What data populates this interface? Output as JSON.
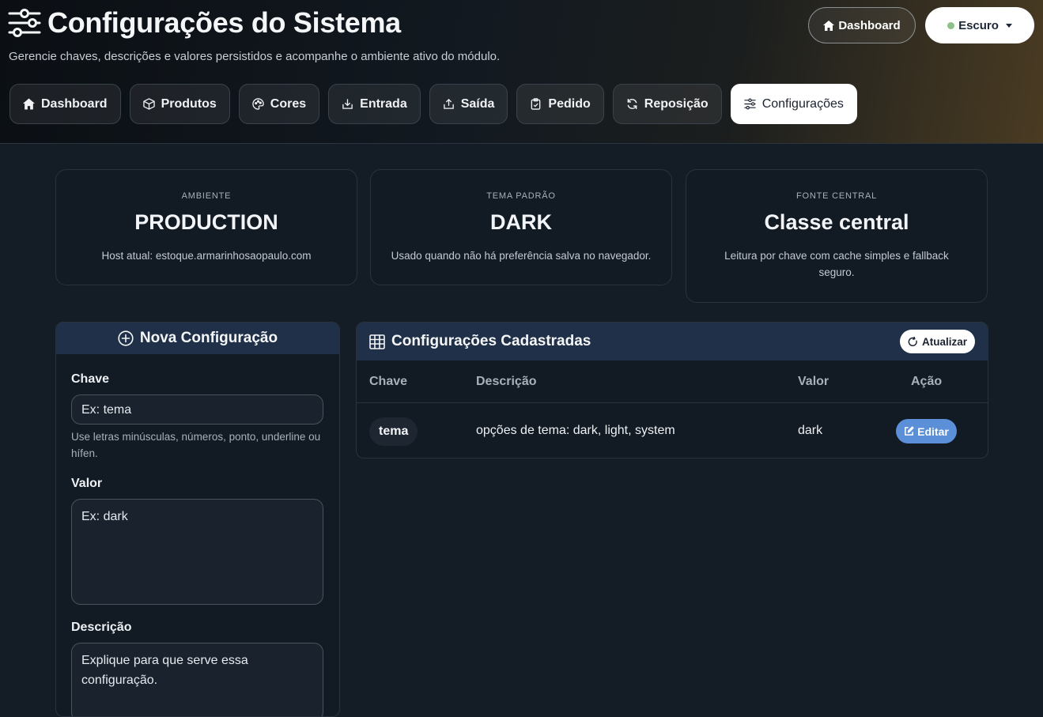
{
  "header": {
    "title": "Configurações do Sistema",
    "subtitle": "Gerencie chaves, descrições e valores persistidos e acompanhe o ambiente ativo do módulo.",
    "dashboard_button": "Dashboard",
    "theme_button": "Escuro"
  },
  "nav": [
    {
      "label": "Dashboard",
      "icon": "home-icon"
    },
    {
      "label": "Produtos",
      "icon": "box-icon"
    },
    {
      "label": "Cores",
      "icon": "palette-icon"
    },
    {
      "label": "Entrada",
      "icon": "download-icon"
    },
    {
      "label": "Saída",
      "icon": "upload-icon"
    },
    {
      "label": "Pedido",
      "icon": "clipboard-check-icon"
    },
    {
      "label": "Reposição",
      "icon": "refresh-icon"
    },
    {
      "label": "Configurações",
      "icon": "sliders-icon",
      "active": true
    }
  ],
  "cards": [
    {
      "label": "AMBIENTE",
      "value": "PRODUCTION",
      "desc": "Host atual: estoque.armarinhosaopaulo.com"
    },
    {
      "label": "TEMA PADRÃO",
      "value": "DARK",
      "desc": "Usado quando não há preferência salva no navegador."
    },
    {
      "label": "FONTE CENTRAL",
      "value": "Classe central",
      "desc": "Leitura por chave com cache simples e fallback seguro."
    }
  ],
  "form": {
    "title": "Nova Configuração",
    "key_label": "Chave",
    "key_placeholder": "Ex: tema",
    "key_help": "Use letras minúsculas, números, ponto, underline ou hífen.",
    "value_label": "Valor",
    "value_placeholder": "Ex: dark",
    "desc_label": "Descrição",
    "desc_placeholder": "Explique para que serve essa configuração."
  },
  "list": {
    "title": "Configurações Cadastradas",
    "refresh_button": "Atualizar",
    "columns": [
      "Chave",
      "Descrição",
      "Valor",
      "Ação"
    ],
    "rows": [
      {
        "key": "tema",
        "description": "opções de tema: dark, light, system",
        "value": "dark",
        "action": "Editar"
      }
    ]
  },
  "colors": {
    "accent": "#5b8fd8",
    "panel_header": "#1f3048",
    "theme_dot": "#8fbf8a"
  }
}
